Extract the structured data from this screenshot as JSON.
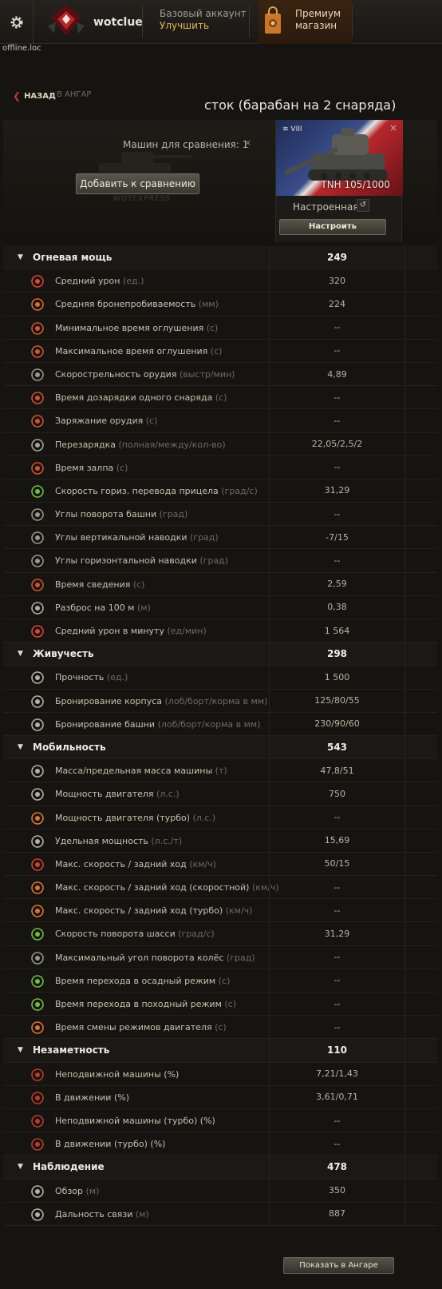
{
  "topbar": {
    "nickname": "wotclue",
    "account_type": "Базовый аккаунт",
    "upgrade": "Улучшить",
    "premium_line1": "Премиум",
    "premium_line2": "магазин",
    "host": "offline.loc"
  },
  "nav": {
    "back": "НАЗАД",
    "to_hangar": "В АНГАР",
    "title": "сток (барабан на 2 снаряда)"
  },
  "compare": {
    "count_label": "Машин для сравнения: 1",
    "close": "×",
    "add_button": "Добавить к сравнению",
    "watermark": "WOTEXPRESS"
  },
  "vehicle": {
    "tier": "VIII",
    "name": "TNH 105/1000",
    "state": "Настроенная",
    "reset": "↺",
    "configure": "Настроить",
    "close": "×",
    "flag_colors": [
      "#1d2b55",
      "#e7e5df",
      "#b7272b"
    ]
  },
  "sections": [
    {
      "title": "Огневая мощь",
      "value": "249",
      "rows": [
        {
          "icon": "damage-icon",
          "color": "#e0442f",
          "label": "Средний урон",
          "unit": "(ед.)",
          "value": "320"
        },
        {
          "icon": "penetration-icon",
          "color": "#e06a2f",
          "label": "Средняя бронепробиваемость",
          "unit": "(мм)",
          "value": "224"
        },
        {
          "icon": "stun-min-icon",
          "color": "#d4572a",
          "label": "Минимальное время оглушения",
          "unit": "(с)",
          "value": "--"
        },
        {
          "icon": "stun-max-icon",
          "color": "#d4572a",
          "label": "Максимальное время оглушения",
          "unit": "(с)",
          "value": "--"
        },
        {
          "icon": "rate-of-fire-icon",
          "color": "#9b968a",
          "label": "Скорострельность орудия",
          "unit": "(выстр/мин)",
          "value": "4,89"
        },
        {
          "icon": "shell-reload-icon",
          "color": "#d3512e",
          "label": "Время дозарядки одного снаряда",
          "unit": "(с)",
          "value": "--"
        },
        {
          "icon": "gun-loading-icon",
          "color": "#d3512e",
          "label": "Заряжание орудия",
          "unit": "(с)",
          "value": "--"
        },
        {
          "icon": "clip-reload-icon",
          "color": "#a9a396",
          "label": "Перезарядка",
          "unit": "(полная/между/кол-во)",
          "value": "22,05/2,5/2"
        },
        {
          "icon": "salvo-icon",
          "color": "#d3512e",
          "label": "Время залпа",
          "unit": "(с)",
          "value": "--"
        },
        {
          "icon": "aim-traverse-icon",
          "color": "#6fbf3b",
          "label": "Скорость гориз. перевода прицела",
          "unit": "(град/с)",
          "value": "31,29"
        },
        {
          "icon": "turret-angle-icon",
          "color": "#9b968a",
          "label": "Углы поворота башни",
          "unit": "(град)",
          "value": "--"
        },
        {
          "icon": "elevation-icon",
          "color": "#9b968a",
          "label": "Углы вертикальной наводки",
          "unit": "(град)",
          "value": "-7/15"
        },
        {
          "icon": "horizontal-aim-icon",
          "color": "#9b968a",
          "label": "Углы горизонтальной наводки",
          "unit": "(град)",
          "value": "--"
        },
        {
          "icon": "aim-time-icon",
          "color": "#d3512e",
          "label": "Время сведения",
          "unit": "(с)",
          "value": "2,59"
        },
        {
          "icon": "dispersion-icon",
          "color": "#b3ad9f",
          "label": "Разброс на 100 м",
          "unit": "(м)",
          "value": "0,38"
        },
        {
          "icon": "dpm-icon",
          "color": "#e0442f",
          "label": "Средний урон в минуту",
          "unit": "(ед/мин)",
          "value": "1 564"
        }
      ]
    },
    {
      "title": "Живучесть",
      "value": "298",
      "rows": [
        {
          "icon": "hit-points-icon",
          "color": "#b6b0a2",
          "label": "Прочность",
          "unit": "(ед.)",
          "value": "1 500"
        },
        {
          "icon": "hull-armor-icon",
          "color": "#b6b0a2",
          "label": "Бронирование корпуса",
          "unit": "(лоб/борт/корма в мм)",
          "value": "125/80/55"
        },
        {
          "icon": "turret-armor-icon",
          "color": "#b6b0a2",
          "label": "Бронирование башни",
          "unit": "(лоб/борт/корма в мм)",
          "value": "230/90/60"
        }
      ]
    },
    {
      "title": "Мобильность",
      "value": "543",
      "rows": [
        {
          "icon": "weight-icon",
          "color": "#b6b0a2",
          "label": "Масса/предельная масса машины",
          "unit": "(т)",
          "value": "47,8/51"
        },
        {
          "icon": "engine-power-icon",
          "color": "#b6b0a2",
          "label": "Мощность двигателя",
          "unit": "(л.с.)",
          "value": "750"
        },
        {
          "icon": "engine-turbo-icon",
          "color": "#e0742f",
          "label": "Мощность двигателя (турбо)",
          "unit": "(л.с.)",
          "value": "--"
        },
        {
          "icon": "specific-power-icon",
          "color": "#b6b0a2",
          "label": "Удельная мощность",
          "unit": "(л.с./т)",
          "value": "15,69"
        },
        {
          "icon": "speed-icon",
          "color": "#d3412e",
          "label": "Макс. скорость / задний ход",
          "unit": "(км/ч)",
          "value": "50/15"
        },
        {
          "icon": "speed-fast-icon",
          "color": "#e0742f",
          "label": "Макс. скорость / задний ход (скоростной)",
          "unit": "(км/ч)",
          "value": "--"
        },
        {
          "icon": "speed-turbo-icon",
          "color": "#e0742f",
          "label": "Макс. скорость / задний ход (турбо)",
          "unit": "(км/ч)",
          "value": "--"
        },
        {
          "icon": "traverse-icon",
          "color": "#6fbf3b",
          "label": "Скорость поворота шасси",
          "unit": "(град/с)",
          "value": "31,29"
        },
        {
          "icon": "wheel-angle-icon",
          "color": "#9b968a",
          "label": "Максимальный угол поворота колёс",
          "unit": "(град)",
          "value": "--"
        },
        {
          "icon": "siege-mode-icon",
          "color": "#6fbf3b",
          "label": "Время перехода в осадный режим",
          "unit": "(с)",
          "value": "--"
        },
        {
          "icon": "travel-mode-icon",
          "color": "#6fbf3b",
          "label": "Время перехода в походный режим",
          "unit": "(с)",
          "value": "--"
        },
        {
          "icon": "engine-mode-icon",
          "color": "#e0742f",
          "label": "Время смены режимов двигателя",
          "unit": "(с)",
          "value": "--"
        }
      ]
    },
    {
      "title": "Незаметность",
      "value": "110",
      "rows": [
        {
          "icon": "camo-stationary-icon",
          "color": "#c0392b",
          "label": "Неподвижной машины (%)",
          "unit": "",
          "value": "7,21/1,43"
        },
        {
          "icon": "camo-moving-icon",
          "color": "#c0392b",
          "label": "В движении (%)",
          "unit": "",
          "value": "3,61/0,71"
        },
        {
          "icon": "camo-stationary-turbo-icon",
          "color": "#c0392b",
          "label": "Неподвижной машины (турбо) (%)",
          "unit": "",
          "value": "--"
        },
        {
          "icon": "camo-moving-turbo-icon",
          "color": "#c0392b",
          "label": "В движении (турбо) (%)",
          "unit": "",
          "value": "--"
        }
      ]
    },
    {
      "title": "Наблюдение",
      "value": "478",
      "rows": [
        {
          "icon": "view-range-icon",
          "color": "#b6b0a2",
          "label": "Обзор",
          "unit": "(м)",
          "value": "350"
        },
        {
          "icon": "radio-range-icon",
          "color": "#b6b0a2",
          "label": "Дальность связи",
          "unit": "(м)",
          "value": "887"
        }
      ]
    }
  ],
  "footer": {
    "show_in_hangar": "Показать в Ангаре"
  }
}
